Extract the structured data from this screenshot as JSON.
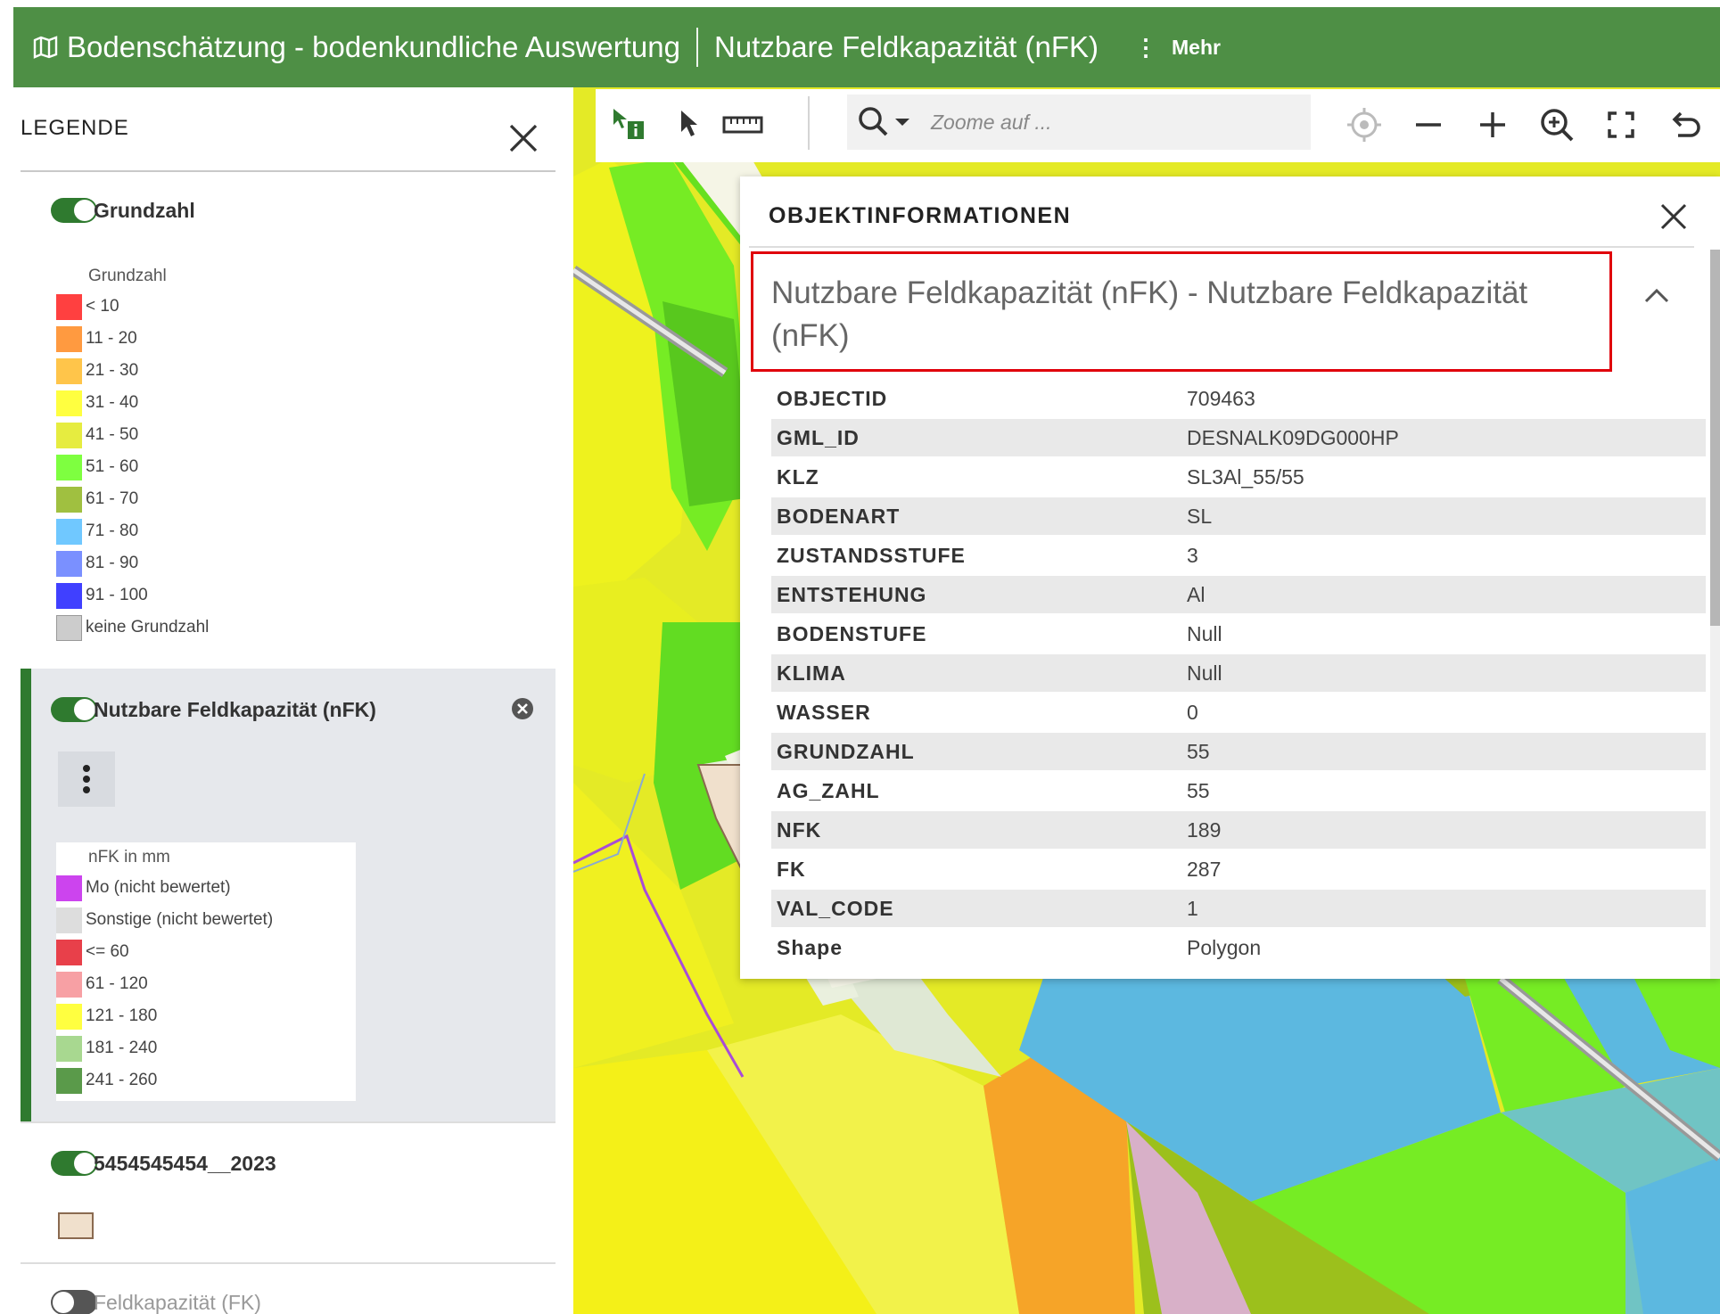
{
  "header": {
    "title": "Bodenschätzung - bodenkundliche Auswertung",
    "subtitle": "Nutzbare Feldkapazität (nFK)",
    "more_label": "Mehr",
    "icon": "map-icon"
  },
  "legend": {
    "heading": "LEGENDE",
    "layers": [
      {
        "name": "Grundzahl",
        "visible": true,
        "legend_title": "Grundzahl",
        "entries": [
          {
            "label": "< 10",
            "color": "#ff4040"
          },
          {
            "label": "11 - 20",
            "color": "#ff9a40"
          },
          {
            "label": "21 - 30",
            "color": "#ffc54a"
          },
          {
            "label": "31 - 40",
            "color": "#ffff40"
          },
          {
            "label": "41 - 50",
            "color": "#e6ec40"
          },
          {
            "label": "51 - 60",
            "color": "#7eff40"
          },
          {
            "label": "61 - 70",
            "color": "#a0c040"
          },
          {
            "label": "71 - 80",
            "color": "#70c8ff"
          },
          {
            "label": "81 - 90",
            "color": "#7a90ff"
          },
          {
            "label": "91 - 100",
            "color": "#4040ff"
          },
          {
            "label": "keine Grundzahl",
            "color": "#cccccc"
          }
        ]
      },
      {
        "name": "Nutzbare Feldkapazität (nFK)",
        "visible": true,
        "active": true,
        "legend_title": "nFK in mm",
        "entries": [
          {
            "label": "Mo (nicht bewertet)",
            "color": "#cc44ee"
          },
          {
            "label": "Sonstige (nicht bewertet)",
            "color": "#dddddd"
          },
          {
            "label": "<= 60",
            "color": "#e8404a"
          },
          {
            "label": "61 - 120",
            "color": "#f7a0a4"
          },
          {
            "label": "121 - 180",
            "color": "#ffff40"
          },
          {
            "label": "181 - 240",
            "color": "#a8d890"
          },
          {
            "label": "241 - 260",
            "color": "#5a9a4a"
          }
        ]
      },
      {
        "name": "5454545454__2023",
        "visible": true,
        "swatch_color": "#f0e0cc"
      },
      {
        "name": "Feldkapazität (FK)",
        "visible": false
      }
    ]
  },
  "toolbar": {
    "search_placeholder": "Zoome auf ...",
    "tools": [
      "info-select-icon",
      "pointer-icon",
      "ruler-icon",
      "search-icon",
      "locate-icon",
      "zoom-out-icon",
      "zoom-in-icon",
      "zoom-to-icon",
      "fullscreen-icon",
      "undo-icon"
    ]
  },
  "popup": {
    "title": "OBJEKTINFORMATIONEN",
    "feature_title": "Nutzbare Feldkapazität (nFK) - Nutzbare Feldkapazität (nFK)",
    "attributes": [
      {
        "key": "OBJECTID",
        "value": "709463"
      },
      {
        "key": "GML_ID",
        "value": "DESNALK09DG000HP"
      },
      {
        "key": "KLZ",
        "value": "SL3Al_55/55"
      },
      {
        "key": "BODENART",
        "value": "SL"
      },
      {
        "key": "ZUSTANDSSTUFE",
        "value": "3"
      },
      {
        "key": "ENTSTEHUNG",
        "value": "Al"
      },
      {
        "key": "BODENSTUFE",
        "value": "Null"
      },
      {
        "key": "KLIMA",
        "value": "Null"
      },
      {
        "key": "WASSER",
        "value": "0"
      },
      {
        "key": "GRUNDZAHL",
        "value": "55"
      },
      {
        "key": "AG_ZAHL",
        "value": "55"
      },
      {
        "key": "NFK",
        "value": "189"
      },
      {
        "key": "FK",
        "value": "287"
      },
      {
        "key": "VAL_CODE",
        "value": "1"
      },
      {
        "key": "Shape",
        "value": "Polygon"
      }
    ]
  }
}
